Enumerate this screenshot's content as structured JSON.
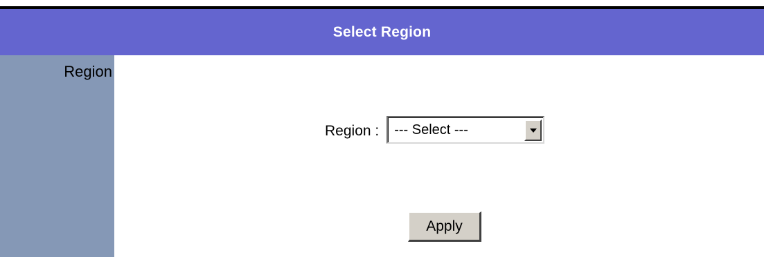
{
  "header": {
    "title": "Select Region"
  },
  "sidebar": {
    "label": "Region"
  },
  "form": {
    "region_label": "Region :",
    "region_select": {
      "selected": "--- Select ---",
      "options": [
        "--- Select ---"
      ]
    },
    "apply_label": "Apply"
  },
  "colors": {
    "header_bg": "#6465cf",
    "sidebar_bg": "#8598b6",
    "button_face": "#d4d0c8"
  }
}
